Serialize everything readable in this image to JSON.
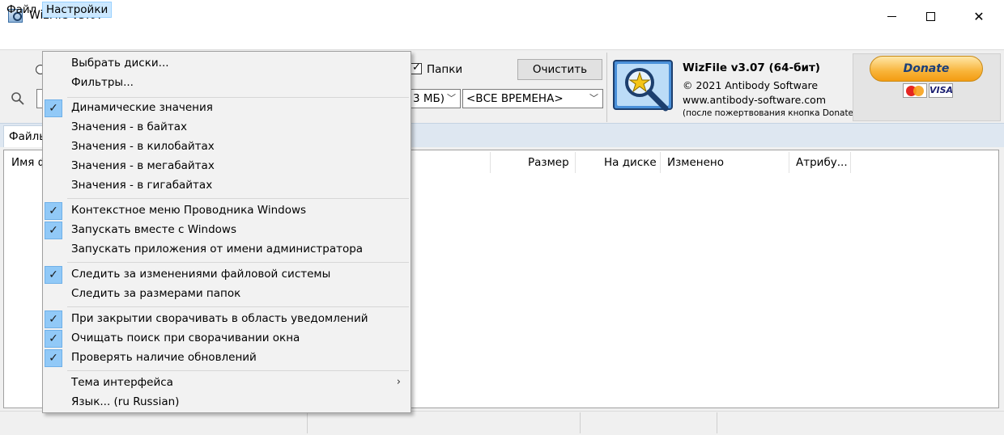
{
  "window": {
    "title": "WizFile v3.07",
    "controls": {
      "minimize": "—",
      "maximize": "□",
      "close": "✕"
    }
  },
  "menubar": {
    "file": "Файл",
    "settings": "Настройки"
  },
  "toolbar": {
    "folders_label": "Папки",
    "folders_checked": true,
    "clear_button": "Очистить",
    "size_filter": "3 МБ)",
    "date_filter": "<ВСЕ ВРЕМЕНА>",
    "search_icon": "magnifier-icon"
  },
  "about": {
    "title": "WizFile v3.07 (64-бит)",
    "copyright": "© 2021 Antibody Software",
    "url": "www.antibody-software.com",
    "note": "(после пожертвования кнопка Donate будет скрыта)"
  },
  "donate": {
    "label": "Donate",
    "card_visa": "VISA",
    "card_mastercard": "mastercard-icon"
  },
  "tabs": {
    "files": "Файлы"
  },
  "list": {
    "columns": {
      "name": "Имя ф",
      "size": "Размер",
      "disk": "На диске",
      "modified": "Изменено",
      "attributes": "Атрибу..."
    }
  },
  "settings_menu": {
    "items": [
      {
        "label": "Выбрать диски...",
        "checked": false
      },
      {
        "label": "Фильтры...",
        "checked": false
      },
      {
        "label": "Динамические значения",
        "checked": true
      },
      {
        "label": "Значения - в байтах",
        "checked": false
      },
      {
        "label": "Значения - в килобайтах",
        "checked": false
      },
      {
        "label": "Значения - в мегабайтах",
        "checked": false
      },
      {
        "label": "Значения - в гигабайтах",
        "checked": false
      },
      {
        "label": "Контекстное меню Проводника Windows",
        "checked": true
      },
      {
        "label": "Запускать вместе с Windows",
        "checked": true
      },
      {
        "label": "Запускать приложения от имени администратора",
        "checked": false
      },
      {
        "label": "Следить за изменениями файловой системы",
        "checked": true
      },
      {
        "label": "Следить за размерами папок",
        "checked": false
      },
      {
        "label": "При закрытии сворачивать в область уведомлений",
        "checked": true
      },
      {
        "label": "Очищать поиск при сворачивании окна",
        "checked": true
      },
      {
        "label": "Проверять наличие обновлений",
        "checked": true
      },
      {
        "label": "Тема интерфейса",
        "checked": false,
        "submenu": true
      },
      {
        "label": "Язык... (ru Russian)",
        "checked": false
      }
    ],
    "check_glyph": "✓",
    "submenu_glyph": "›"
  }
}
